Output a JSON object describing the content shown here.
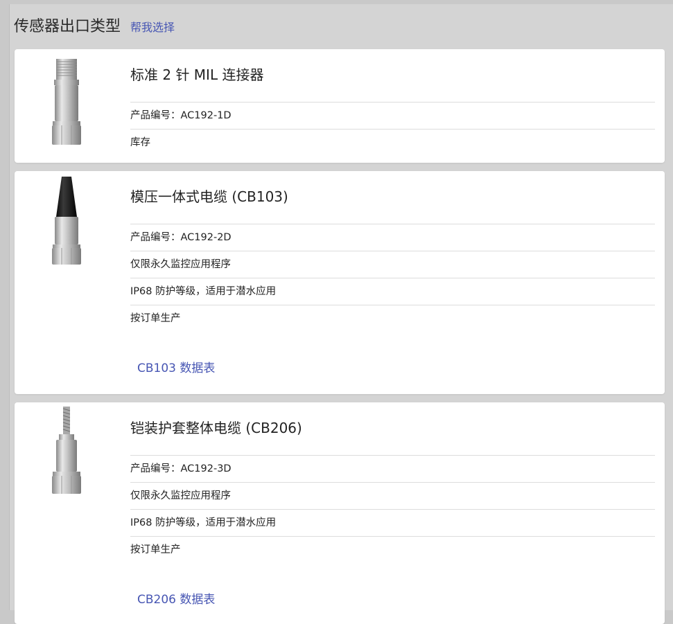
{
  "header": {
    "title": "传感器出口类型",
    "help_link": "帮我选择"
  },
  "products": [
    {
      "name": "标准 2 针 MIL 连接器",
      "rows": [
        "产品编号：AC192-1D",
        "库存"
      ],
      "link": "",
      "image": "mil-connector-sensor-icon"
    },
    {
      "name": "模压一体式电缆 (CB103)",
      "rows": [
        "产品编号：AC192-2D",
        "仅限永久监控应用程序",
        "IP68 防护等级，适用于潜水应用",
        "按订单生产"
      ],
      "link": "CB103 数据表",
      "image": "molded-cable-sensor-icon"
    },
    {
      "name": "铠装护套整体电缆 (CB206)",
      "rows": [
        "产品编号：AC192-3D",
        "仅限永久监控应用程序",
        "IP68 防护等级，适用于潜水应用",
        "按订单生产"
      ],
      "link": "CB206 数据表",
      "image": "armored-cable-sensor-icon"
    }
  ]
}
